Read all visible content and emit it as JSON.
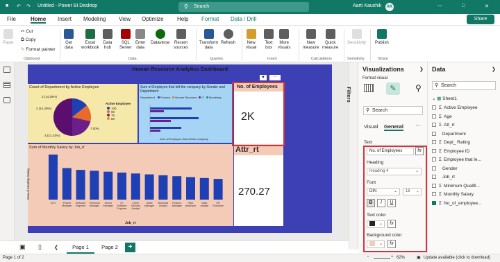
{
  "titlebar": {
    "title": "Untitled - Power BI Desktop",
    "search": "Search",
    "user": "Aarti Kaushik",
    "avatar": "AK"
  },
  "menu": {
    "items": [
      "File",
      "Home",
      "Insert",
      "Modeling",
      "View",
      "Optimize",
      "Help",
      "Format",
      "Data / Drill"
    ],
    "active": "Home",
    "share": "Share"
  },
  "ribbon": {
    "clipboard": {
      "paste": "Paste",
      "cut": "Cut",
      "copy": "Copy",
      "format_painter": "Format painter",
      "group": "Clipboard"
    },
    "data": {
      "get_data": "Get\ndata",
      "excel": "Excel\nworkbook",
      "data_hub": "Data\nhub",
      "sql": "SQL\nServer",
      "enter": "Enter\ndata",
      "dataverse": "Dataverse",
      "recent": "Recent\nsources",
      "group": "Data"
    },
    "queries": {
      "transform": "Transform\ndata",
      "refresh": "Refresh",
      "group": "Queries"
    },
    "insert": {
      "new_visual": "New\nvisual",
      "text_box": "Text\nbox",
      "more_visuals": "More\nvisuals",
      "group": "Insert"
    },
    "calc": {
      "new_measure": "New\nmeasure",
      "quick_measure": "Quick\nmeasure",
      "group": "Calculations"
    },
    "sensitivity": {
      "label": "Sensitivity",
      "group": "Sensitivity"
    },
    "share": {
      "publish": "Publish",
      "group": "Share"
    }
  },
  "report": {
    "title": "Human Resource Analytics Dashboard",
    "pie": {
      "title": "Count of Department by Active Employee",
      "legend_title": "Active Employee",
      "legend": [
        "100",
        "90",
        "75",
        "80"
      ],
      "labels": [
        "2 (14.29%)",
        "2 (14.29%)",
        "3 (21.43%)",
        "7.00%"
      ]
    },
    "gender": {
      "title": "Sum of Employee that left the company by Gender and Department",
      "legend_label": "Department",
      "legend": [
        "Finance",
        "Human Resource",
        "IT",
        "Marketing"
      ],
      "xlabel": "Sum of Employee that left the company"
    },
    "card1": {
      "title": "No. of Employees",
      "value": "2K"
    },
    "card2": {
      "title": "Attr_rt",
      "value": "270.27"
    },
    "bar": {
      "title": "Sum of Monthly Salary by Job_rt",
      "ylabel": "Sum of Monthly Salary",
      "xlabel": "Job_rt",
      "categories": [
        "CFO",
        "Project Manager",
        "Software Engineer",
        "Technical Manager",
        "Senior Manager",
        "Sr. Software Engineer",
        "Cyber Security Analyst",
        "Sales Manager",
        "Business Analyst",
        "Finance Manager",
        "VBA developer",
        "Data Analyst",
        "HR Executive"
      ],
      "values": [
        100,
        70,
        66,
        64,
        62,
        60,
        58,
        56,
        54,
        52,
        50,
        48,
        46
      ]
    }
  },
  "tabs": {
    "page1": "Page 1",
    "page2": "Page 2",
    "add": "+"
  },
  "status": {
    "left": "Page 1 of 2",
    "update": "Update available (click to download)",
    "zoom": "62%"
  },
  "filters_label": "Filters",
  "viz": {
    "title": "Visualizations",
    "format_visual": "Format visual",
    "search": "Search",
    "tab_visual": "Visual",
    "tab_general": "General",
    "more": "···",
    "section": "Text",
    "text_value": "No. of Employees",
    "heading_label": "Heading",
    "heading_value": "Heading 4",
    "font_label": "Font",
    "font_value": "DIN",
    "font_size": "18",
    "bold": "B",
    "italic": "I",
    "underline": "U",
    "text_color_label": "Text color",
    "bg_color_label": "Background color",
    "fx": "fx"
  },
  "data": {
    "title": "Data",
    "search": "Search",
    "table": "Sheet1",
    "fields": [
      "Active Employee",
      "Age",
      "Att_rt",
      "Department",
      "Dept_ Rating",
      "Employee ID",
      "Employee that le...",
      "Gender",
      "Job_rt",
      "Minimum Qualifi...",
      "Monthly Salary",
      "No_of_employee..."
    ]
  }
}
